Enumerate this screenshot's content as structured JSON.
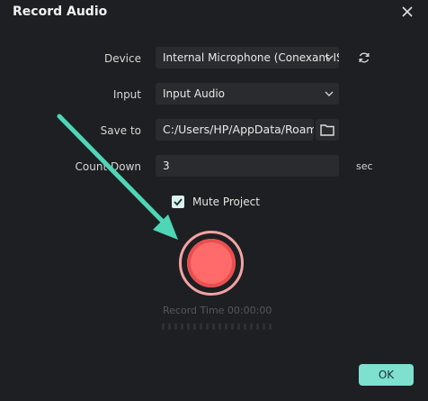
{
  "window": {
    "title": "Record Audio"
  },
  "form": {
    "device_label": "Device",
    "device_value": "Internal Microphone (Conexant IS",
    "input_label": "Input",
    "input_value": "Input Audio",
    "save_label": "Save to",
    "save_value": "C:/Users/HP/AppData/Roam",
    "countdown_label": "Count Down",
    "countdown_value": "3",
    "countdown_unit": "sec",
    "mute_label": "Mute Project",
    "mute_checked": true
  },
  "record": {
    "time_text": "Record Time 00:00:00"
  },
  "footer": {
    "ok_label": "OK"
  },
  "colors": {
    "accent": "#7ee0cf",
    "record": "#ff6a6a",
    "annotation_arrow": "#4ed6b6"
  }
}
